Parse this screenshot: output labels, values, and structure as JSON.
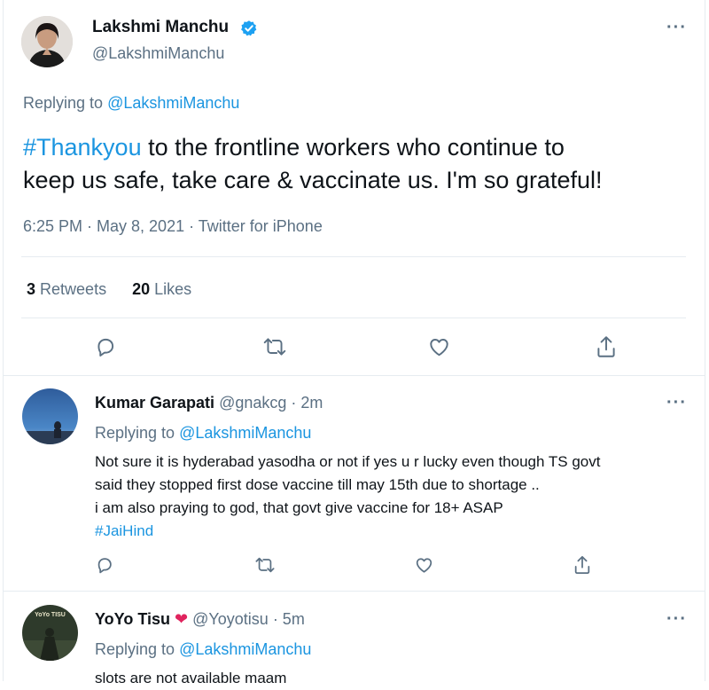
{
  "main_tweet": {
    "author_name": "Lakshmi Manchu",
    "author_handle": "@LakshmiManchu",
    "replying_label": "Replying to",
    "replying_handle": "@LakshmiManchu",
    "hashtag": "#Thankyou",
    "text_rest_line1": " to the frontline workers who continue to",
    "text_line2": "keep us safe, take care & vaccinate us. I'm so grateful!",
    "timestamp": "6:25 PM · May 8, 2021 · Twitter for iPhone",
    "retweets_count": "3",
    "retweets_label": "Retweets",
    "likes_count": "20",
    "likes_label": "Likes",
    "more_label": "···"
  },
  "replies": [
    {
      "author_name": "Kumar Garapati",
      "author_handle": "@gnakcg",
      "time": " · 2m",
      "replying_label": "Replying to",
      "replying_handle": "@LakshmiManchu",
      "line1": "Not sure it is hyderabad yasodha or not if yes u r lucky even though TS govt",
      "line2": "said they stopped first dose vaccine till may 15th due to shortage ..",
      "line3": "i am also praying to god, that govt give vaccine for 18+ ASAP",
      "hashtag": "#JaiHind",
      "more_label": "···"
    },
    {
      "author_name": "YoYo Tisu",
      "author_emoji": "❤",
      "author_handle": "@Yoyotisu",
      "time": " · 5m",
      "avatar_text": "YoYo TISU",
      "replying_label": "Replying to",
      "replying_handle": "@LakshmiManchu",
      "line1": "slots are not available maam",
      "more_label": "···"
    }
  ],
  "icons": [
    "reply-icon",
    "retweet-icon",
    "like-icon",
    "share-icon",
    "verified-badge-icon"
  ],
  "colors": {
    "link": "#1b95e0",
    "secondary": "#5b7083",
    "verified": "#1da1f2",
    "divider": "#e6ecf0"
  }
}
